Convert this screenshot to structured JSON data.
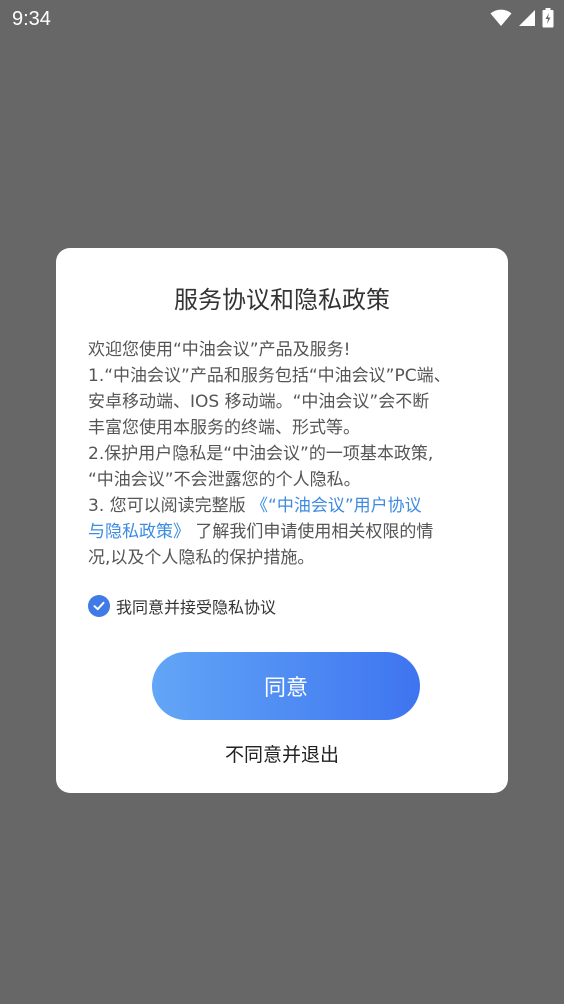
{
  "status_bar": {
    "time": "9:34",
    "icons": [
      "wifi-icon",
      "signal-icon",
      "battery-icon"
    ]
  },
  "dialog": {
    "title": "服务协议和隐私政策",
    "body_lines": [
      "欢迎您使用“中油会议”产品及服务!",
      "1.“中油会议”产品和服务包括“中油会议”PC端、",
      "安卓移动端、IOS 移动端。“中油会议”会不断",
      "丰富您使用本服务的终端、形式等。",
      "2.保护用户隐私是“中油会议”的一项基本政策,",
      "“中油会议”不会泄露您的个人隐私。"
    ],
    "item3_prefix": "3. 您可以阅读完整版 ",
    "link_part1": "《“中油会议”用户协议",
    "link_part2": "与隐私政策》",
    "item3_suffix": " 了解我们申请使用相关权限的情",
    "item3_last": "况,以及个人隐私的保护措施。",
    "agree_checkbox_label": "我同意并接受隐私协议",
    "agree_button": "同意",
    "disagree_button": "不同意并退出",
    "accent_color": "#3f7ae6",
    "link_color": "#3c8be0"
  }
}
